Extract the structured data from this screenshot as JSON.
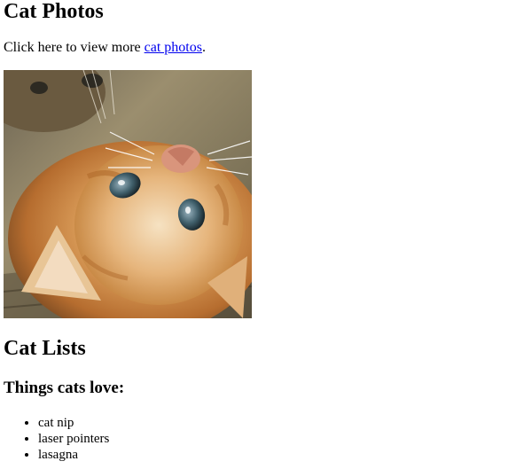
{
  "headings": {
    "photos": "Cat Photos",
    "lists": "Cat Lists",
    "things_love": "Things cats love:"
  },
  "intro": {
    "prefix": "Click here to view more ",
    "link_text": "cat photos",
    "suffix": "."
  },
  "image": {
    "alt": "A cute orange cat lying on its back."
  },
  "love_list": [
    "cat nip",
    "laser pointers",
    "lasagna"
  ],
  "colors": {
    "link": "#0000ee",
    "text": "#000000",
    "background": "#ffffff"
  }
}
